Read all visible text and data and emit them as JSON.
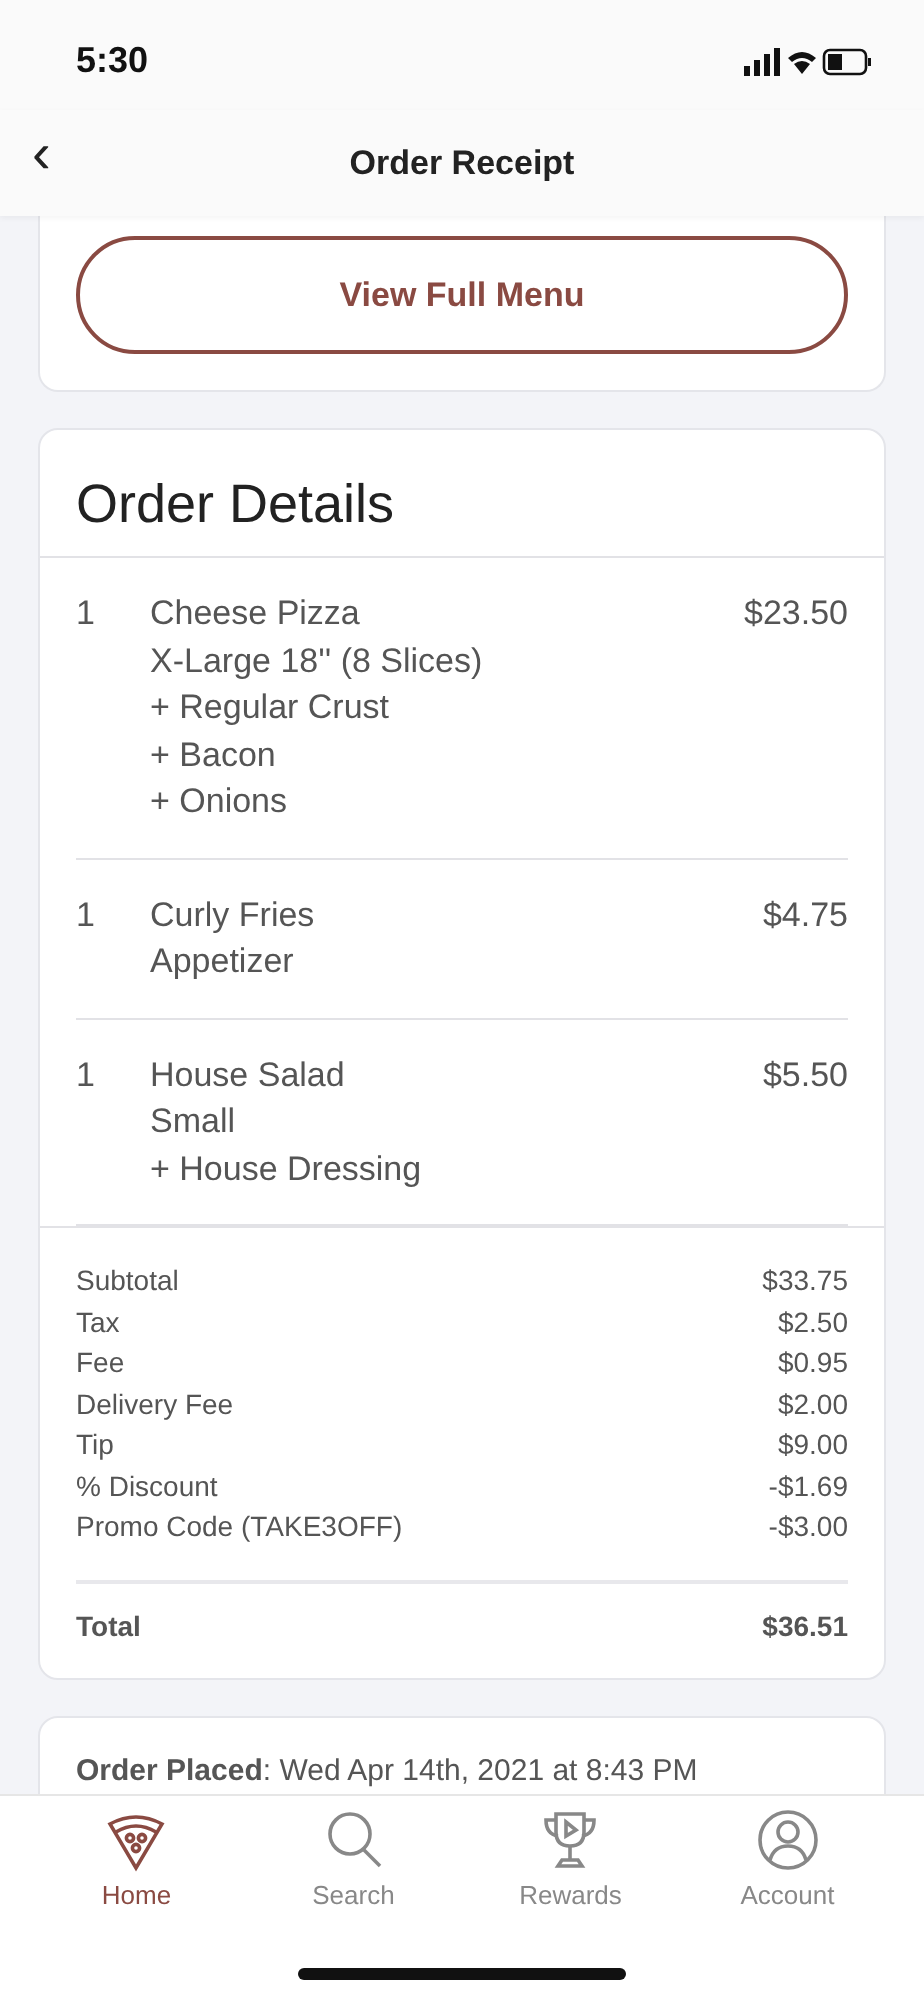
{
  "status_bar": {
    "time": "5:30"
  },
  "header": {
    "back": "‹",
    "title": "Order Receipt"
  },
  "menu_button": {
    "label": "View Full Menu"
  },
  "order_details": {
    "title": "Order Details",
    "items": [
      {
        "qty": "1",
        "name": "Cheese Pizza",
        "details": [
          "X-Large 18'' (8 Slices)",
          "+ Regular Crust",
          "+ Bacon",
          "+ Onions"
        ],
        "price": "$23.50"
      },
      {
        "qty": "1",
        "name": "Curly Fries",
        "details": [
          "Appetizer"
        ],
        "price": "$4.75"
      },
      {
        "qty": "1",
        "name": "House Salad",
        "details": [
          "Small",
          "+ House Dressing"
        ],
        "price": "$5.50"
      }
    ],
    "summary": [
      {
        "label": "Subtotal",
        "value": "$33.75"
      },
      {
        "label": "Tax",
        "value": "$2.50"
      },
      {
        "label": "Fee",
        "value": "$0.95"
      },
      {
        "label": "Delivery Fee",
        "value": "$2.00"
      },
      {
        "label": "Tip",
        "value": "$9.00"
      },
      {
        "label": "% Discount",
        "value": "-$1.69"
      },
      {
        "label": "Promo Code (TAKE3OFF)",
        "value": "-$3.00"
      }
    ],
    "total": {
      "label": "Total",
      "value": "$36.51"
    }
  },
  "order_info": {
    "placed": "**Order Placed**: Wed Apr 14th, 2021 at 8:43 PM"
  },
  "tab_bar": [
    {
      "kind": "home",
      "label": "Home",
      "selected": true
    },
    {
      "kind": "search",
      "label": "Search",
      "selected": false
    },
    {
      "kind": "rewards",
      "label": "Rewards",
      "selected": false
    },
    {
      "kind": "account",
      "label": "Account",
      "selected": false
    }
  ]
}
